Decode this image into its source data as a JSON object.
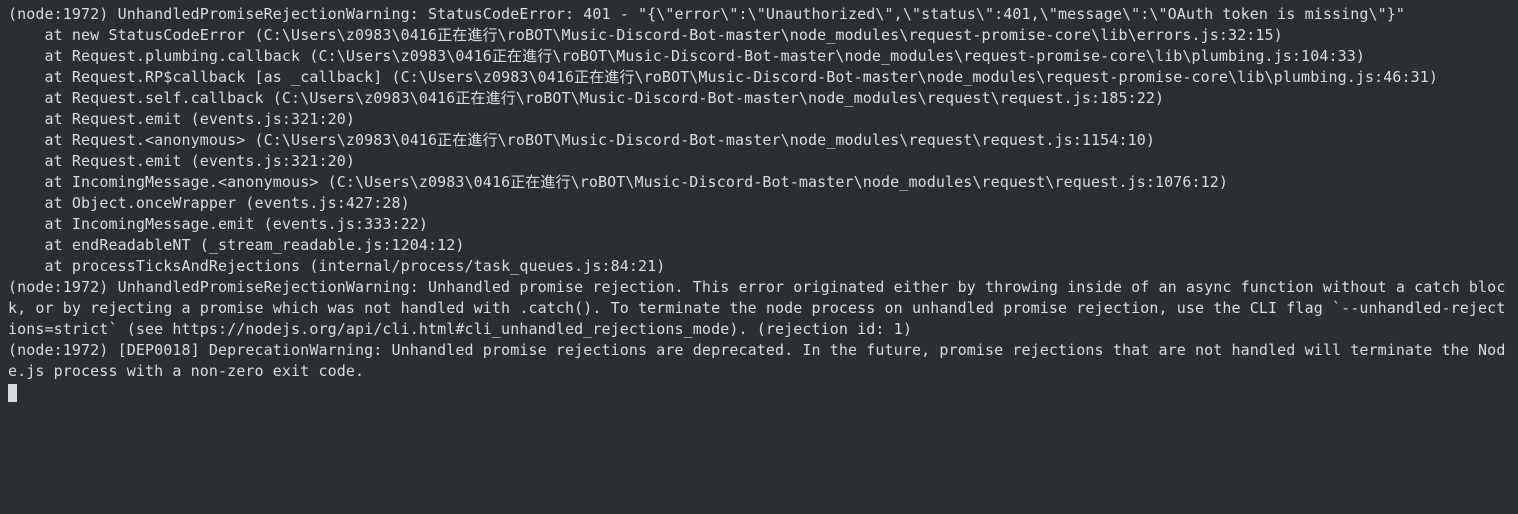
{
  "terminal": {
    "lines": [
      "(node:1972) UnhandledPromiseRejectionWarning: StatusCodeError: 401 - \"{\\\"error\\\":\\\"Unauthorized\\\",\\\"status\\\":401,\\\"message\\\":\\\"OAuth token is missing\\\"}\"",
      "    at new StatusCodeError (C:\\Users\\z0983\\0416正在進行\\roBOT\\Music-Discord-Bot-master\\node_modules\\request-promise-core\\lib\\errors.js:32:15)",
      "    at Request.plumbing.callback (C:\\Users\\z0983\\0416正在進行\\roBOT\\Music-Discord-Bot-master\\node_modules\\request-promise-core\\lib\\plumbing.js:104:33)",
      "    at Request.RP$callback [as _callback] (C:\\Users\\z0983\\0416正在進行\\roBOT\\Music-Discord-Bot-master\\node_modules\\request-promise-core\\lib\\plumbing.js:46:31)",
      "    at Request.self.callback (C:\\Users\\z0983\\0416正在進行\\roBOT\\Music-Discord-Bot-master\\node_modules\\request\\request.js:185:22)",
      "    at Request.emit (events.js:321:20)",
      "    at Request.<anonymous> (C:\\Users\\z0983\\0416正在進行\\roBOT\\Music-Discord-Bot-master\\node_modules\\request\\request.js:1154:10)",
      "    at Request.emit (events.js:321:20)",
      "    at IncomingMessage.<anonymous> (C:\\Users\\z0983\\0416正在進行\\roBOT\\Music-Discord-Bot-master\\node_modules\\request\\request.js:1076:12)",
      "    at Object.onceWrapper (events.js:427:28)",
      "    at IncomingMessage.emit (events.js:333:22)",
      "    at endReadableNT (_stream_readable.js:1204:12)",
      "    at processTicksAndRejections (internal/process/task_queues.js:84:21)",
      "(node:1972) UnhandledPromiseRejectionWarning: Unhandled promise rejection. This error originated either by throwing inside of an async function without a catch block, or by rejecting a promise which was not handled with .catch(). To terminate the node process on unhandled promise rejection, use the CLI flag `--unhandled-rejections=strict` (see https://nodejs.org/api/cli.html#cli_unhandled_rejections_mode). (rejection id: 1)",
      "(node:1972) [DEP0018] DeprecationWarning: Unhandled promise rejections are deprecated. In the future, promise rejections that are not handled will terminate the Node.js process with a non-zero exit code."
    ]
  }
}
